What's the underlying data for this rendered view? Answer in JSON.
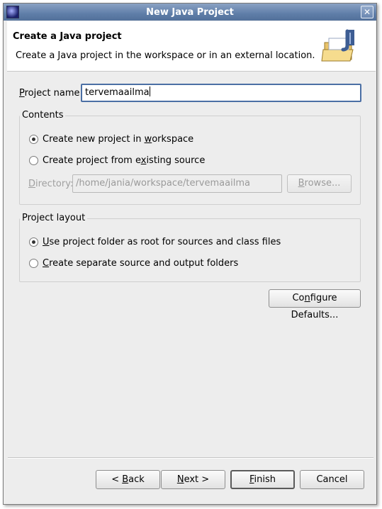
{
  "window": {
    "title": "New Java Project"
  },
  "header": {
    "title_pre": "Create a ",
    "title_mnem": "J",
    "title_post": "ava project",
    "description": "Create a Java project in the workspace or in an external location."
  },
  "project_name": {
    "label_mnem": "P",
    "label_rest": "roject name:",
    "value": "tervemaailma"
  },
  "contents": {
    "legend": "Contents",
    "option_new": {
      "pre": "Create new project in ",
      "mnem": "w",
      "post": "orkspace",
      "checked": true
    },
    "option_existing": {
      "pre": "Create project from e",
      "mnem": "x",
      "post": "isting source",
      "checked": false
    },
    "directory": {
      "label_mnem": "D",
      "label_rest": "irectory:",
      "value": "/home/jania/workspace/tervemaailma"
    },
    "browse": {
      "mnem": "B",
      "rest": "rowse..."
    }
  },
  "layout": {
    "legend": "Project layout",
    "option_root": {
      "mnem": "U",
      "rest": "se project folder as root for sources and class files",
      "checked": true
    },
    "option_separate": {
      "mnem": "C",
      "rest": "reate separate source and output folders",
      "checked": false
    }
  },
  "configure": {
    "pre": "Co",
    "mnem": "n",
    "post": "figure Defaults..."
  },
  "footer": {
    "back": {
      "pre": "< ",
      "mnem": "B",
      "post": "ack"
    },
    "next": {
      "mnem": "N",
      "post": "ext >"
    },
    "finish": {
      "mnem": "F",
      "post": "inish"
    },
    "cancel": "Cancel"
  }
}
